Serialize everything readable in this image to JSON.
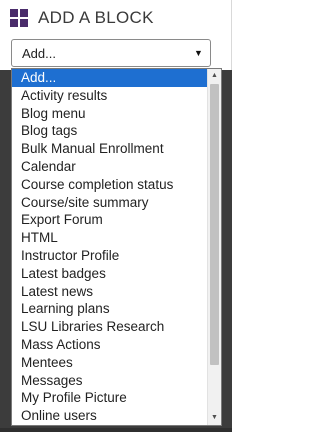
{
  "block_panel": {
    "title": "ADD A BLOCK",
    "icon": "grid-icon",
    "select": {
      "value": "Add...",
      "arrow": "▼"
    }
  },
  "dropdown": {
    "options": [
      "Add...",
      "Activity results",
      "Blog menu",
      "Blog tags",
      "Bulk Manual Enrollment",
      "Calendar",
      "Course completion status",
      "Course/site summary",
      "Export Forum",
      "HTML",
      "Instructor Profile",
      "Latest badges",
      "Latest news",
      "Learning plans",
      "LSU Libraries Research",
      "Mass Actions",
      "Mentees",
      "Messages",
      "My Profile Picture",
      "Online users"
    ],
    "selected_index": 0,
    "scroll_up_glyph": "▲",
    "scroll_down_glyph": "▼"
  },
  "colors": {
    "accent_purple": "#4a2c6b",
    "selection_blue": "#1e6fd1"
  }
}
